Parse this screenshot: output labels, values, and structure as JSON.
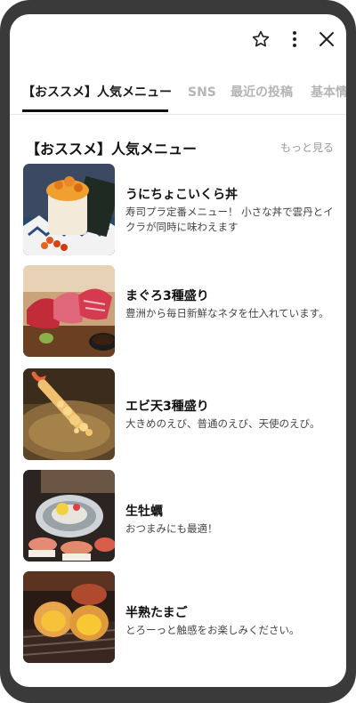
{
  "icons": {
    "favorite": "star-outline-icon",
    "more": "vertical-ellipsis-icon",
    "close": "close-x-icon"
  },
  "tabs": [
    {
      "label": "【おススメ】人気メニュー",
      "active": true
    },
    {
      "label": "SNS",
      "active": false
    },
    {
      "label": "最近の投稿",
      "active": false
    },
    {
      "label": "基本情",
      "active": false
    }
  ],
  "section": {
    "title": "【おススメ】人気メニュー",
    "more_label": "もっと見る"
  },
  "menu_items": [
    {
      "name": "うにちょこいくら丼",
      "description": "寿司プラ定番メニュー！ 小さな丼で雲丹とイクラが同時に味わえます"
    },
    {
      "name": "まぐろ3種盛り",
      "description": "豊洲から毎日新鮮なネタを仕入れています。"
    },
    {
      "name": "エビ天3種盛り",
      "description": "大きめのえび、普通のえび、天使のえび。"
    },
    {
      "name": "生牡蠣",
      "description": "おつまみにも最適！"
    },
    {
      "name": "半熟たまご",
      "description": "とろーっと触感をお楽しみください。"
    }
  ]
}
